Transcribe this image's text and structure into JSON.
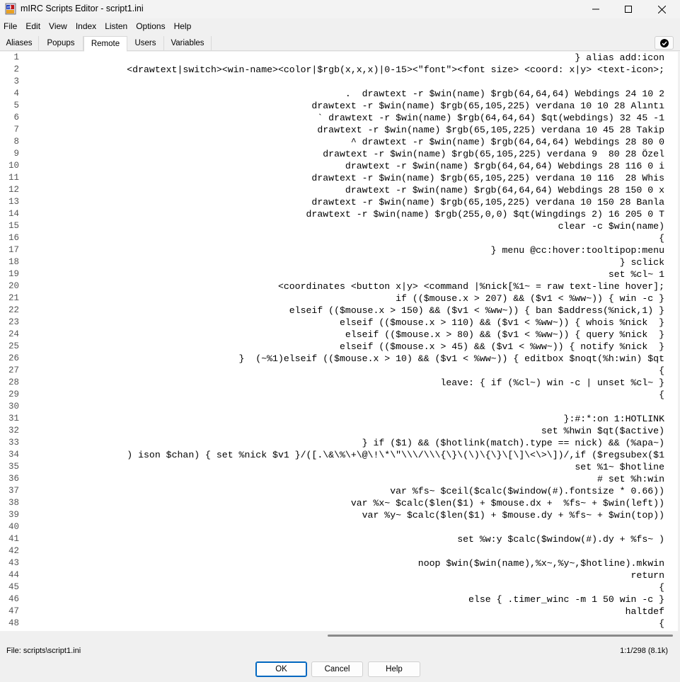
{
  "window": {
    "title": "mIRC Scripts Editor - script1.ini",
    "app_icon": "mirc-icon",
    "controls": [
      "minimize-icon",
      "maximize-icon",
      "close-icon"
    ]
  },
  "menubar": {
    "items": [
      "File",
      "Edit",
      "View",
      "Index",
      "Listen",
      "Options",
      "Help"
    ]
  },
  "tabs": {
    "items": [
      "Aliases",
      "Popups",
      "Remote",
      "Users",
      "Variables"
    ],
    "active": "Remote"
  },
  "toolbar": {
    "check_icon": "checkmark-circle-icon"
  },
  "editor": {
    "lines": [
      {
        "n": "1",
        "text": "} alias add:icon"
      },
      {
        "n": "2",
        "text": "<drawtext|switch><win-name><color|$rgb(x,x,x)|0-15><\"font\"><font size> <coord: x|y> <text-icon>;"
      },
      {
        "n": "3",
        "text": ""
      },
      {
        "n": "4",
        "text": ".  drawtext -r $win(name) $rgb(64,64,64) Webdings 24 10 2"
      },
      {
        "n": "5",
        "text": "drawtext -r $win(name) $rgb(65,105,225) verdana 10 10 28 Alıntı"
      },
      {
        "n": "6",
        "text": "` drawtext -r $win(name) $rgb(64,64,64) $qt(webdings) 32 45 -1"
      },
      {
        "n": "7",
        "text": "drawtext -r $win(name) $rgb(65,105,225) verdana 10 45 28 Takip"
      },
      {
        "n": "8",
        "text": "^ drawtext -r $win(name) $rgb(64,64,64) Webdings 28 80 0"
      },
      {
        "n": "9",
        "text": "drawtext -r $win(name) $rgb(65,105,225) verdana 9  80 28 Özel"
      },
      {
        "n": "10",
        "text": "drawtext -r $win(name) $rgb(64,64,64) Webdings 28 116 0 i"
      },
      {
        "n": "11",
        "text": "drawtext -r $win(name) $rgb(65,105,225) verdana 10 116  28 Whis"
      },
      {
        "n": "12",
        "text": "drawtext -r $win(name) $rgb(64,64,64) Webdings 28 150 0 x"
      },
      {
        "n": "13",
        "text": "drawtext -r $win(name) $rgb(65,105,225) verdana 10 150 28 Banla"
      },
      {
        "n": "14",
        "text": "drawtext -r $win(name) $rgb(255,0,0) $qt(Wingdings 2) 16 205 0 T"
      },
      {
        "n": "15",
        "text": "clear -c $win(name)"
      },
      {
        "n": "16",
        "text": "{"
      },
      {
        "n": "17",
        "text": "} menu @cc:hover:tooltipop:menu"
      },
      {
        "n": "18",
        "text": "} sclick"
      },
      {
        "n": "19",
        "text": "set %cl~ 1"
      },
      {
        "n": "20",
        "text": "<coordinates <button x|y> <command |%nick[%1~ = raw text-line hover];"
      },
      {
        "n": "21",
        "text": "if (($mouse.x > 207) && ($v1 < %ww~)) { win -c }"
      },
      {
        "n": "22",
        "text": "elseif (($mouse.x > 150) && ($v1 < %ww~)) { ban $address(%nick,1) }"
      },
      {
        "n": "23",
        "text": "elseif (($mouse.x > 110) && ($v1 < %ww~)) { whois %nick  }"
      },
      {
        "n": "24",
        "text": "elseif (($mouse.x > 80) && ($v1 < %ww~)) { query %nick  }"
      },
      {
        "n": "25",
        "text": "elseif (($mouse.x > 45) && ($v1 < %ww~)) { notify %nick  }"
      },
      {
        "n": "26",
        "text": "}  (~%1)elseif (($mouse.x > 10) && ($v1 < %ww~)) { editbox $noqt(%h:win) $qt"
      },
      {
        "n": "27",
        "text": "{"
      },
      {
        "n": "28",
        "text": "leave: { if (%cl~) win -c | unset %cl~ }"
      },
      {
        "n": "29",
        "text": "{"
      },
      {
        "n": "30",
        "text": ""
      },
      {
        "n": "31",
        "text": "}:#:*:on 1:HOTLINK"
      },
      {
        "n": "32",
        "text": "set %hwin $qt($active)"
      },
      {
        "n": "33",
        "text": "} if ($1) && ($hotlink(match).type == nick) && (%apa~)"
      },
      {
        "n": "34",
        "text": ") ison $chan) { set %nick $v1 }/([.\\&\\%\\+\\@\\!\\*\\\"\\\\\\/\\\\\\{\\}\\(\\)\\{\\}\\[\\]\\<\\>\\])/,if ($regsubex($1"
      },
      {
        "n": "35",
        "text": "set %1~ $hotline"
      },
      {
        "n": "36",
        "text": "# set %h:win"
      },
      {
        "n": "37",
        "text": "var %fs~ $ceil($calc($window(#).fontsize * 0.66))"
      },
      {
        "n": "38",
        "text": "var %x~ $calc($len($1) + $mouse.dx +  %fs~ + $win(left))"
      },
      {
        "n": "39",
        "text": "var %y~ $calc($len($1) + $mouse.dy + %fs~ + $win(top))"
      },
      {
        "n": "40",
        "text": ""
      },
      {
        "n": "41",
        "text": "set %w:y $calc($window(#).dy + %fs~ )"
      },
      {
        "n": "42",
        "text": ""
      },
      {
        "n": "43",
        "text": "noop $win($win(name),%x~,%y~,$hotline).mkwin"
      },
      {
        "n": "44",
        "text": "return"
      },
      {
        "n": "45",
        "text": "{"
      },
      {
        "n": "46",
        "text": "else { .timer_winc -m 1 50 win -c }"
      },
      {
        "n": "47",
        "text": "haltdef"
      },
      {
        "n": "48",
        "text": "{"
      }
    ]
  },
  "status": {
    "file": "File: scripts\\script1.ini",
    "position": "1:1/298 (8.1k)"
  },
  "buttons": {
    "ok": "OK",
    "cancel": "Cancel",
    "help": "Help"
  }
}
